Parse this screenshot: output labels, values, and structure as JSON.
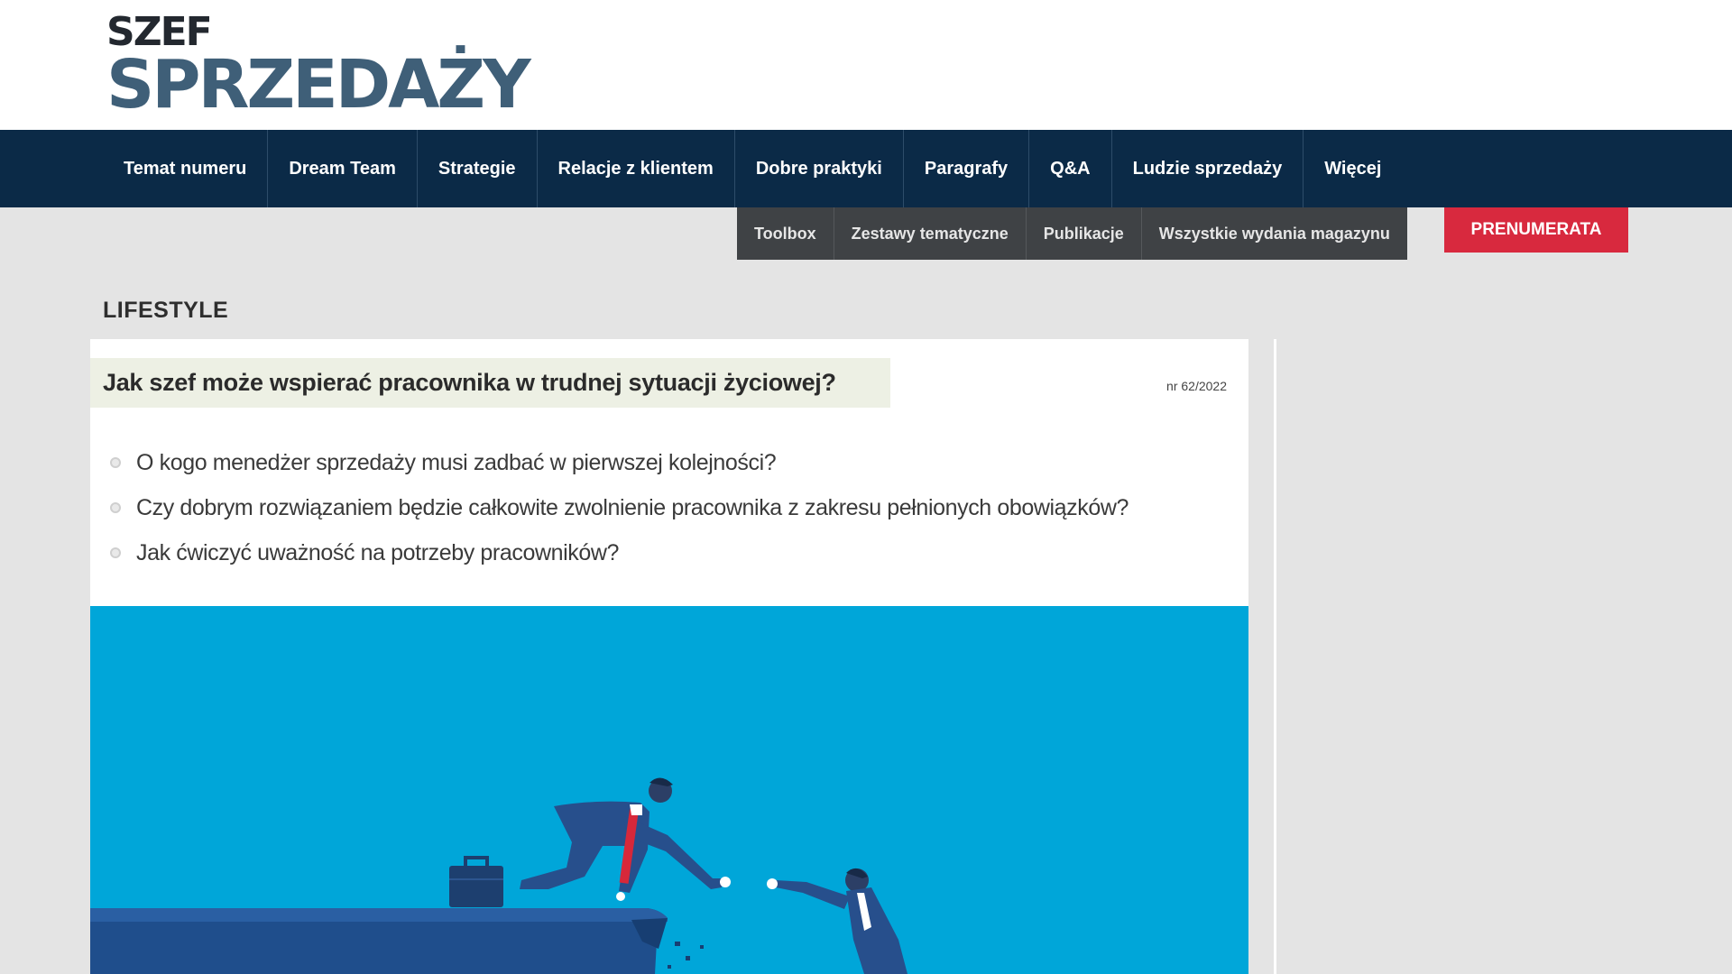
{
  "logo": {
    "line1": "SZEF",
    "line2": "SPRZEDAŻY"
  },
  "main_nav": [
    "Temat numeru",
    "Dream Team",
    "Strategie",
    "Relacje z klientem",
    "Dobre praktyki",
    "Paragrafy",
    "Q&A",
    "Ludzie sprzedaży",
    "Więcej"
  ],
  "sub_nav": [
    "Toolbox",
    "Zestawy tematyczne",
    "Publikacje",
    "Wszystkie wydania magazynu"
  ],
  "subscribe_label": "PRENUMERATA",
  "section_label": "LIFESTYLE",
  "article": {
    "title": "Jak szef może wspierać pracownika w trudnej sytuacji życiowej?",
    "issue": "nr 62/2022",
    "bullets": [
      "O kogo menedżer sprzedaży musi zadbać w pierwszej kolejności?",
      "Czy dobrym rozwiązaniem będzie całkowite zwolnienie pracownika z zakresu pełnionych obowiązków?",
      "Jak ćwiczyć uważność na potrzeby pracowników?"
    ]
  },
  "colors": {
    "nav_bg": "#0b2a47",
    "subnav_bg": "#3f4245",
    "subscribe_bg": "#d8293e",
    "hero_bg": "#00a6d9",
    "logo_dark": "#23282f",
    "logo_blue": "#3f5f78"
  }
}
